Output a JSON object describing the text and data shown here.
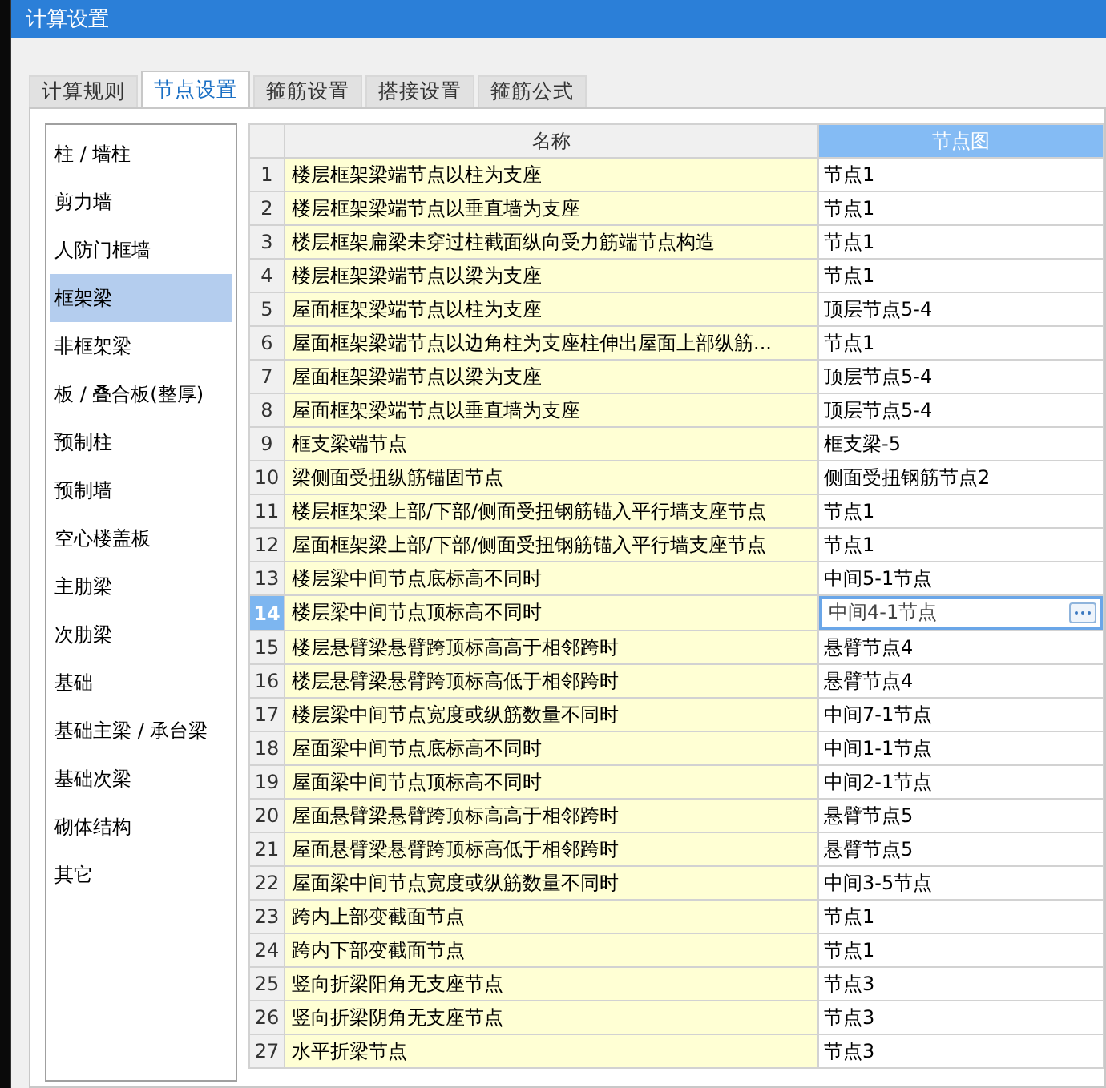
{
  "window": {
    "title": "计算设置"
  },
  "tabs": [
    {
      "label": "计算规则",
      "selected": false
    },
    {
      "label": "节点设置",
      "selected": true
    },
    {
      "label": "箍筋设置",
      "selected": false
    },
    {
      "label": "搭接设置",
      "selected": false
    },
    {
      "label": "箍筋公式",
      "selected": false
    }
  ],
  "categories": [
    {
      "label": "柱 / 墙柱",
      "selected": false
    },
    {
      "label": "剪力墙",
      "selected": false
    },
    {
      "label": "人防门框墙",
      "selected": false
    },
    {
      "label": "框架梁",
      "selected": true
    },
    {
      "label": "非框架梁",
      "selected": false
    },
    {
      "label": "板 / 叠合板(整厚)",
      "selected": false
    },
    {
      "label": "预制柱",
      "selected": false
    },
    {
      "label": "预制墙",
      "selected": false
    },
    {
      "label": "空心楼盖板",
      "selected": false
    },
    {
      "label": "主肋梁",
      "selected": false
    },
    {
      "label": "次肋梁",
      "selected": false
    },
    {
      "label": "基础",
      "selected": false
    },
    {
      "label": "基础主梁 / 承台梁",
      "selected": false
    },
    {
      "label": "基础次梁",
      "selected": false
    },
    {
      "label": "砌体结构",
      "selected": false
    },
    {
      "label": "其它",
      "selected": false
    }
  ],
  "table": {
    "columns": [
      {
        "label": "名称",
        "selected": false
      },
      {
        "label": "节点图",
        "selected": true
      }
    ],
    "rows": [
      {
        "number": "1",
        "name": "楼层框架梁端节点以柱为支座",
        "node": "节点1",
        "selected": false
      },
      {
        "number": "2",
        "name": "楼层框架梁端节点以垂直墙为支座",
        "node": "节点1",
        "selected": false
      },
      {
        "number": "3",
        "name": "楼层框架扁梁未穿过柱截面纵向受力筋端节点构造",
        "node": "节点1",
        "selected": false
      },
      {
        "number": "4",
        "name": "楼层框架梁端节点以梁为支座",
        "node": "节点1",
        "selected": false
      },
      {
        "number": "5",
        "name": "屋面框架梁端节点以柱为支座",
        "node": "顶层节点5-4",
        "selected": false
      },
      {
        "number": "6",
        "name": "屋面框架梁端节点以边角柱为支座柱伸出屋面上部纵筋...",
        "node": "节点1",
        "selected": false
      },
      {
        "number": "7",
        "name": "屋面框架梁端节点以梁为支座",
        "node": "顶层节点5-4",
        "selected": false
      },
      {
        "number": "8",
        "name": "屋面框架梁端节点以垂直墙为支座",
        "node": "顶层节点5-4",
        "selected": false
      },
      {
        "number": "9",
        "name": "框支梁端节点",
        "node": "框支梁-5",
        "selected": false
      },
      {
        "number": "10",
        "name": "梁侧面受扭纵筋锚固节点",
        "node": "侧面受扭钢筋节点2",
        "selected": false
      },
      {
        "number": "11",
        "name": "楼层框架梁上部/下部/侧面受扭钢筋锚入平行墙支座节点",
        "node": "节点1",
        "selected": false
      },
      {
        "number": "12",
        "name": "屋面框架梁上部/下部/侧面受扭钢筋锚入平行墙支座节点",
        "node": "节点1",
        "selected": false
      },
      {
        "number": "13",
        "name": "楼层梁中间节点底标高不同时",
        "node": "中间5-1节点",
        "selected": false
      },
      {
        "number": "14",
        "name": "楼层梁中间节点顶标高不同时",
        "node": "中间4-1节点",
        "selected": true
      },
      {
        "number": "15",
        "name": "楼层悬臂梁悬臂跨顶标高高于相邻跨时",
        "node": "悬臂节点4",
        "selected": false
      },
      {
        "number": "16",
        "name": "楼层悬臂梁悬臂跨顶标高低于相邻跨时",
        "node": "悬臂节点4",
        "selected": false
      },
      {
        "number": "17",
        "name": "楼层梁中间节点宽度或纵筋数量不同时",
        "node": "中间7-1节点",
        "selected": false
      },
      {
        "number": "18",
        "name": "屋面梁中间节点底标高不同时",
        "node": "中间1-1节点",
        "selected": false
      },
      {
        "number": "19",
        "name": "屋面梁中间节点顶标高不同时",
        "node": "中间2-1节点",
        "selected": false
      },
      {
        "number": "20",
        "name": "屋面悬臂梁悬臂跨顶标高高于相邻跨时",
        "node": "悬臂节点5",
        "selected": false
      },
      {
        "number": "21",
        "name": "屋面悬臂梁悬臂跨顶标高低于相邻跨时",
        "node": "悬臂节点5",
        "selected": false
      },
      {
        "number": "22",
        "name": "屋面梁中间节点宽度或纵筋数量不同时",
        "node": "中间3-5节点",
        "selected": false
      },
      {
        "number": "23",
        "name": "跨内上部变截面节点",
        "node": "节点1",
        "selected": false
      },
      {
        "number": "24",
        "name": "跨内下部变截面节点",
        "node": "节点1",
        "selected": false
      },
      {
        "number": "25",
        "name": "竖向折梁阳角无支座节点",
        "node": "节点3",
        "selected": false
      },
      {
        "number": "26",
        "name": "竖向折梁阴角无支座节点",
        "node": "节点3",
        "selected": false
      },
      {
        "number": "27",
        "name": "水平折梁节点",
        "node": "节点3",
        "selected": false
      }
    ]
  }
}
